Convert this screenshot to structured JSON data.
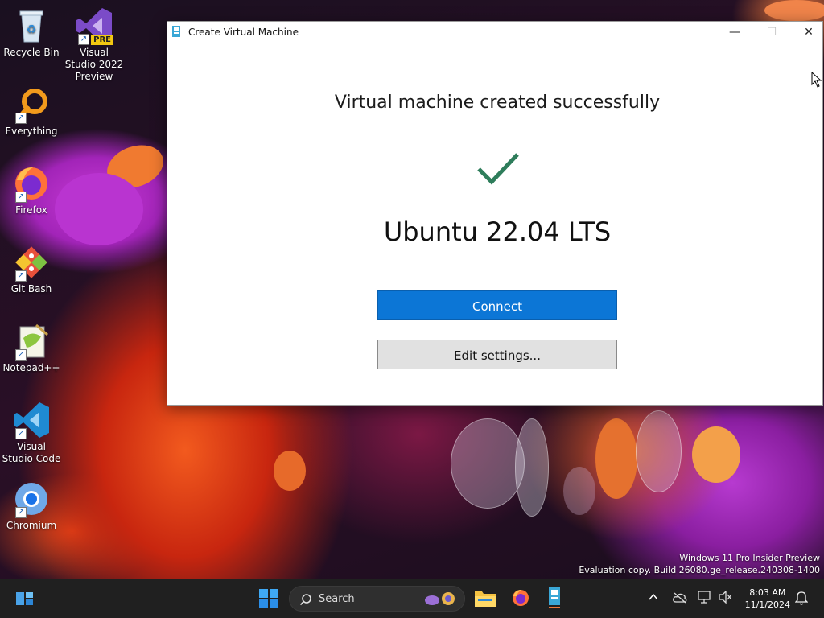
{
  "desktop": {
    "icons": [
      {
        "label": "Recycle Bin"
      },
      {
        "label": "Visual Studio 2022 Preview",
        "badge": "PRE"
      },
      {
        "label": "Everything"
      },
      {
        "label": "Firefox"
      },
      {
        "label": "Git Bash"
      },
      {
        "label": "Notepad++"
      },
      {
        "label": "Visual Studio Code"
      },
      {
        "label": "Chromium"
      }
    ],
    "watermark": {
      "line1": "Windows 11 Pro Insider Preview",
      "line2": "Evaluation copy. Build 26080.ge_release.240308-1400"
    }
  },
  "window": {
    "title": "Create Virtual Machine",
    "minimize_glyph": "—",
    "maximize_glyph": "☐",
    "close_glyph": "✕",
    "heading": "Virtual machine created successfully",
    "vm_name": "Ubuntu 22.04 LTS",
    "connect_label": "Connect",
    "edit_settings_label": "Edit settings..."
  },
  "taskbar": {
    "search_placeholder": "Search",
    "time": "8:03 AM",
    "date": "11/1/2024"
  },
  "colors": {
    "accent": "#0c76d6",
    "check": "#2e7d5b",
    "taskbar": "#202020"
  }
}
